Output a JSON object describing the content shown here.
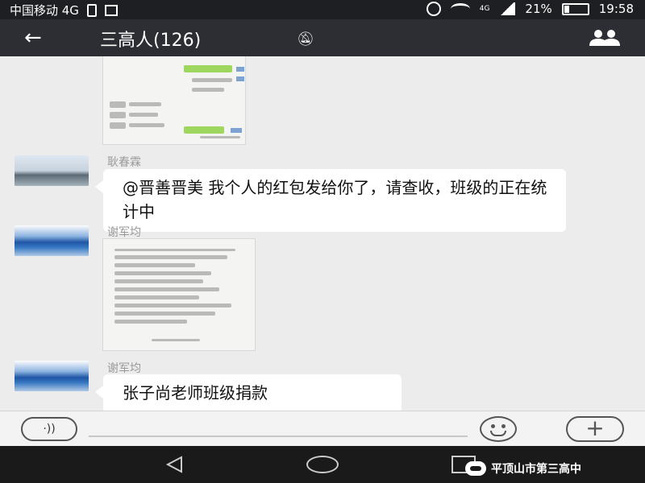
{
  "status_bar": {
    "carrier": "中国移动 4G",
    "network_badge": "4G",
    "battery": "21%",
    "time": "19:58"
  },
  "header": {
    "title": "三高人(126)",
    "back_icon": "back-arrow-icon",
    "mute_icon": "bell-muted-icon",
    "members_icon": "group-members-icon"
  },
  "messages": [
    {
      "type": "image",
      "sender": "",
      "content": "screenshot-image"
    },
    {
      "type": "text",
      "sender": "耿春霖",
      "text": "@晋善晋美  我个人的红包发给你了，请查收，班级的正在统计中"
    },
    {
      "type": "image",
      "sender": "谢军均",
      "content": "document-image"
    },
    {
      "type": "text",
      "sender": "谢军均",
      "text": "张子尚老师班级捐款"
    }
  ],
  "input_bar": {
    "voice_icon": "voice-toggle-icon",
    "emoji_icon": "emoji-icon",
    "plus_icon": "plus-icon",
    "plus_label": "+"
  },
  "watermark": {
    "text": "平顶山市第三高中",
    "icon": "wechat-icon"
  },
  "colors": {
    "header_bg": "#2d2e33",
    "chat_bg": "#ececec",
    "bubble_bg": "#ffffff",
    "status_bar_bg": "#1e1f22"
  }
}
